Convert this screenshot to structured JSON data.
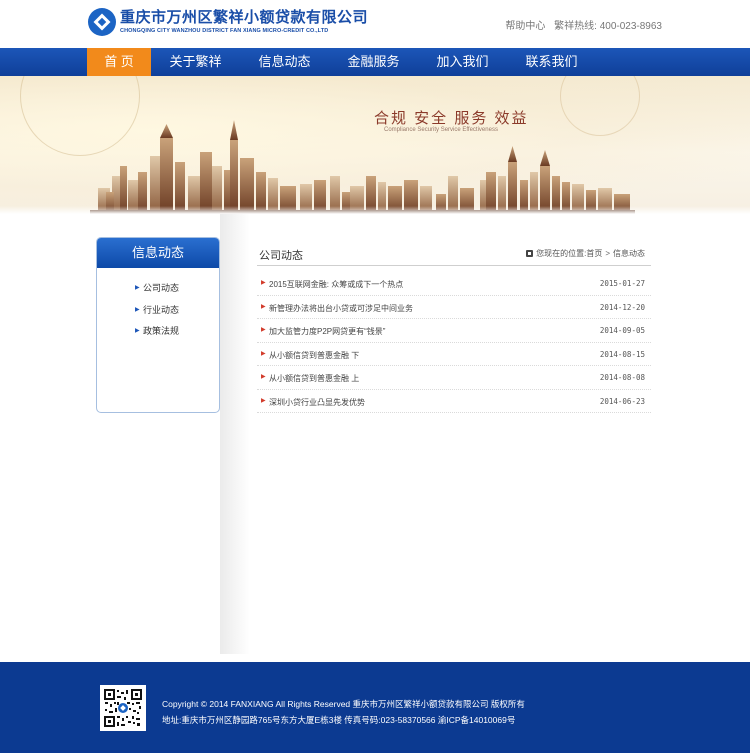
{
  "header": {
    "logo_cn": "重庆市万州区繁祥小额贷款有限公司",
    "logo_en": "CHONGQING CITY WANZHOU DISTRICT FAN XIANG MICRO-CREDIT CO.,LTD",
    "help_link": "帮助中心",
    "hotline": "繁祥热线: 400-023-8963"
  },
  "nav": {
    "items": [
      {
        "label": "首 页",
        "active": true
      },
      {
        "label": "关于繁祥"
      },
      {
        "label": "信息动态"
      },
      {
        "label": "金融服务"
      },
      {
        "label": "加入我们"
      },
      {
        "label": "联系我们"
      }
    ]
  },
  "banner": {
    "slogan": "合规 安全 服务 效益",
    "slogan_en": "Compliance Security Service Effectiveness"
  },
  "sidebar": {
    "title": "信息动态",
    "items": [
      {
        "label": "公司动态"
      },
      {
        "label": "行业动态"
      },
      {
        "label": "政策法规"
      }
    ]
  },
  "main": {
    "title": "公司动态",
    "breadcrumb": {
      "prefix": "您现在的位置:",
      "home": "首页",
      "separator": ">",
      "current": "信息动态"
    },
    "news": [
      {
        "title": "2015互联网金融: 众筹或成下一个热点",
        "date": "2015-01-27"
      },
      {
        "title": "新管理办法将出台小贷或可涉足中间业务",
        "date": "2014-12-20"
      },
      {
        "title": "加大监管力度P2P网贷更有“钱景”",
        "date": "2014-09-05"
      },
      {
        "title": "从小额信贷到普惠金融 下",
        "date": "2014-08-15"
      },
      {
        "title": "从小额信贷到普惠金融 上",
        "date": "2014-08-08"
      },
      {
        "title": "深圳小贷行业凸显先发优势",
        "date": "2014-06-23"
      }
    ]
  },
  "footer": {
    "copyright": "Copyright © 2014 FANXIANG All Rights Reserved 重庆市万州区繁祥小额贷款有限公司 版权所有",
    "address": "地址:重庆市万州区静园路765号东方大厦E栋3楼 传真号码:023-58370566 渝ICP备14010069号"
  },
  "colors": {
    "brand_blue": "#1c56b8",
    "nav_active": "#f28a1b",
    "footer_bg": "#0c3a91",
    "news_arrow": "#d23b2b"
  },
  "icons": {
    "logo": "diamond-circle-logo-icon",
    "breadcrumb": "home-icon",
    "news_bullet": "triangle-arrow-icon",
    "sidebar_bullet": "triangle-bullet-icon",
    "footer": "qr-code-icon"
  }
}
